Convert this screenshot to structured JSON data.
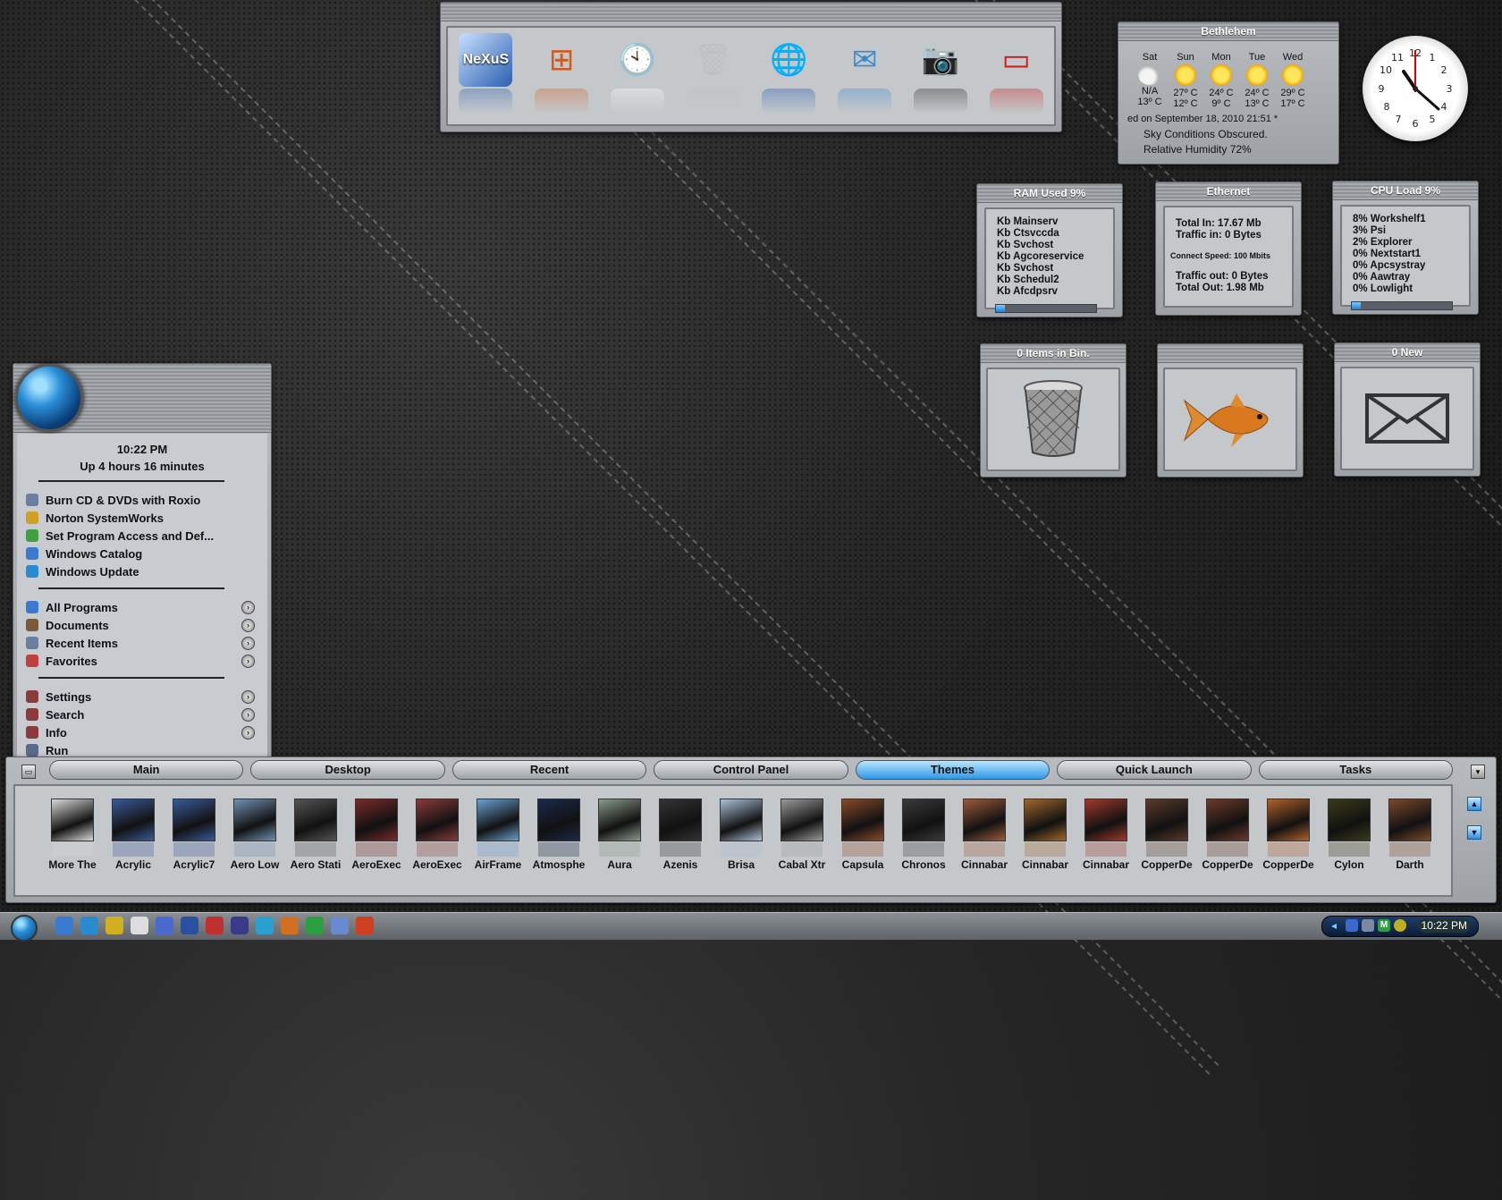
{
  "dock": {
    "icons": [
      {
        "name": "nexus-icon",
        "glyph": "NeXuS",
        "color": "#2a5fb0"
      },
      {
        "name": "windows-flag-icon",
        "glyph": "⊞",
        "color": "#d25a1a"
      },
      {
        "name": "clock-icon",
        "glyph": "🕙",
        "color": "#ffffff"
      },
      {
        "name": "recycle-bin-icon",
        "glyph": "🗑",
        "color": "#c0c0c0"
      },
      {
        "name": "internet-globe-icon",
        "glyph": "🌐",
        "color": "#1c55b0"
      },
      {
        "name": "email-icon",
        "glyph": "✉",
        "color": "#3a8ad0"
      },
      {
        "name": "camera-icon",
        "glyph": "📷",
        "color": "#222222"
      },
      {
        "name": "etch-a-sketch-icon",
        "glyph": "▭",
        "color": "#cc1a1a"
      }
    ]
  },
  "weather": {
    "title": "Bethlehem",
    "days": [
      {
        "day": "Sat",
        "hi": "N/A",
        "lo": "13º C",
        "icon": "cloud"
      },
      {
        "day": "Sun",
        "hi": "27º C",
        "lo": "12º C",
        "icon": "sun"
      },
      {
        "day": "Mon",
        "hi": "24º C",
        "lo": "9º C",
        "icon": "sun"
      },
      {
        "day": "Tue",
        "hi": "24º C",
        "lo": "13º C",
        "icon": "sun"
      },
      {
        "day": "Wed",
        "hi": "29º C",
        "lo": "17º C",
        "icon": "sun"
      }
    ],
    "updated": "ed on September 18, 2010 21:51 *",
    "conditions": "Sky Conditions Obscured.",
    "humidity": "Relative Humidity 72%"
  },
  "ram": {
    "title": "RAM Used 9%",
    "lines": [
      "Kb Mainserv",
      "Kb Ctsvccda",
      "Kb Svchost",
      "Kb Agcoreservice",
      "Kb Svchost",
      "Kb Schedul2",
      "Kb Afcdpsrv"
    ],
    "level": 0.09
  },
  "ethernet": {
    "title": "Ethernet",
    "total_in": "Total In: 17.67 Mb",
    "traffic_in": "Traffic in: 0 Bytes",
    "speed": "Connect Speed: 100 Mbits",
    "traffic_out": "Traffic out: 0 Bytes",
    "total_out": "Total Out: 1.98 Mb"
  },
  "cpu": {
    "title": "CPU Load 9%",
    "lines": [
      "8% Workshelf1",
      "3% Psi",
      "2% Explorer",
      "0% Nextstart1",
      "0% Apcsystray",
      "0% Aawtray",
      "0% Lowlight"
    ],
    "level": 0.09
  },
  "bin": {
    "title": "0 Items in Bin."
  },
  "mail": {
    "title": "0 New"
  },
  "startmenu": {
    "time": "10:22 PM",
    "uptime": "Up 4 hours 16 minutes",
    "group1": [
      {
        "label": "Burn CD & DVDs with Roxio",
        "color": "#6a7fa0"
      },
      {
        "label": "Norton SystemWorks",
        "color": "#d0a020"
      },
      {
        "label": "Set Program Access and Def...",
        "color": "#40a040"
      },
      {
        "label": "Windows Catalog",
        "color": "#3a7ad0"
      },
      {
        "label": "Windows Update",
        "color": "#2a8ad0"
      }
    ],
    "group2": [
      {
        "label": "All Programs",
        "color": "#3a7ad0"
      },
      {
        "label": "Documents",
        "color": "#7a5a3a"
      },
      {
        "label": "Recent Items",
        "color": "#6a7fa0"
      },
      {
        "label": "Favorites",
        "color": "#c04040"
      }
    ],
    "group3": [
      {
        "label": "Settings",
        "color": "#8a3a3a"
      },
      {
        "label": "Search",
        "color": "#8a3a3a"
      },
      {
        "label": "Info",
        "color": "#8a3a3a"
      },
      {
        "label": "Run",
        "color": "#5a6a8a"
      }
    ]
  },
  "bottombar": {
    "tabs": [
      "Main",
      "Desktop",
      "Recent",
      "Control Panel",
      "Themes",
      "Quick Launch",
      "Tasks"
    ],
    "active_tab": "Themes",
    "themes": [
      {
        "label": "More The",
        "color": "#d8d8d8"
      },
      {
        "label": "Acrylic",
        "color": "#3a5a9a"
      },
      {
        "label": "Acrylic7",
        "color": "#3a5a9a"
      },
      {
        "label": "Aero Low",
        "color": "#7090b0"
      },
      {
        "label": "Aero Stati",
        "color": "#555555"
      },
      {
        "label": "AeroExec",
        "color": "#7a2a2a"
      },
      {
        "label": "AeroExec",
        "color": "#8a3a3a"
      },
      {
        "label": "AirFrame",
        "color": "#6aa0d0"
      },
      {
        "label": "Atmosphe",
        "color": "#1a2a4a"
      },
      {
        "label": "Aura",
        "color": "#8a9a8a"
      },
      {
        "label": "Azenis",
        "color": "#333333"
      },
      {
        "label": "Brisa",
        "color": "#aac0d8"
      },
      {
        "label": "Cabal Xtr",
        "color": "#9a9a9a"
      },
      {
        "label": "Capsula",
        "color": "#8a4a2a"
      },
      {
        "label": "Chronos",
        "color": "#3a3a3a"
      },
      {
        "label": "Cinnabar",
        "color": "#9a5a3a"
      },
      {
        "label": "Cinnabar",
        "color": "#a0662a"
      },
      {
        "label": "Cinnabar",
        "color": "#a03a2a"
      },
      {
        "label": "CopperDe",
        "color": "#5a3a2a"
      },
      {
        "label": "CopperDe",
        "color": "#6a3a2a"
      },
      {
        "label": "CopperDe",
        "color": "#b0602a"
      },
      {
        "label": "Cylon",
        "color": "#3a3a1a"
      },
      {
        "label": "Darth",
        "color": "#7a4a2a"
      }
    ]
  },
  "taskbar": {
    "quicklaunch": [
      "desktop-icon",
      "ie-icon",
      "tools-icon",
      "help-icon",
      "globe-icon",
      "media-icon",
      "sound-icon",
      "network-icon",
      "settings-icon",
      "flash-icon",
      "update-icon",
      "web-icon",
      "chrome-icon"
    ],
    "time": "10:22 PM"
  }
}
